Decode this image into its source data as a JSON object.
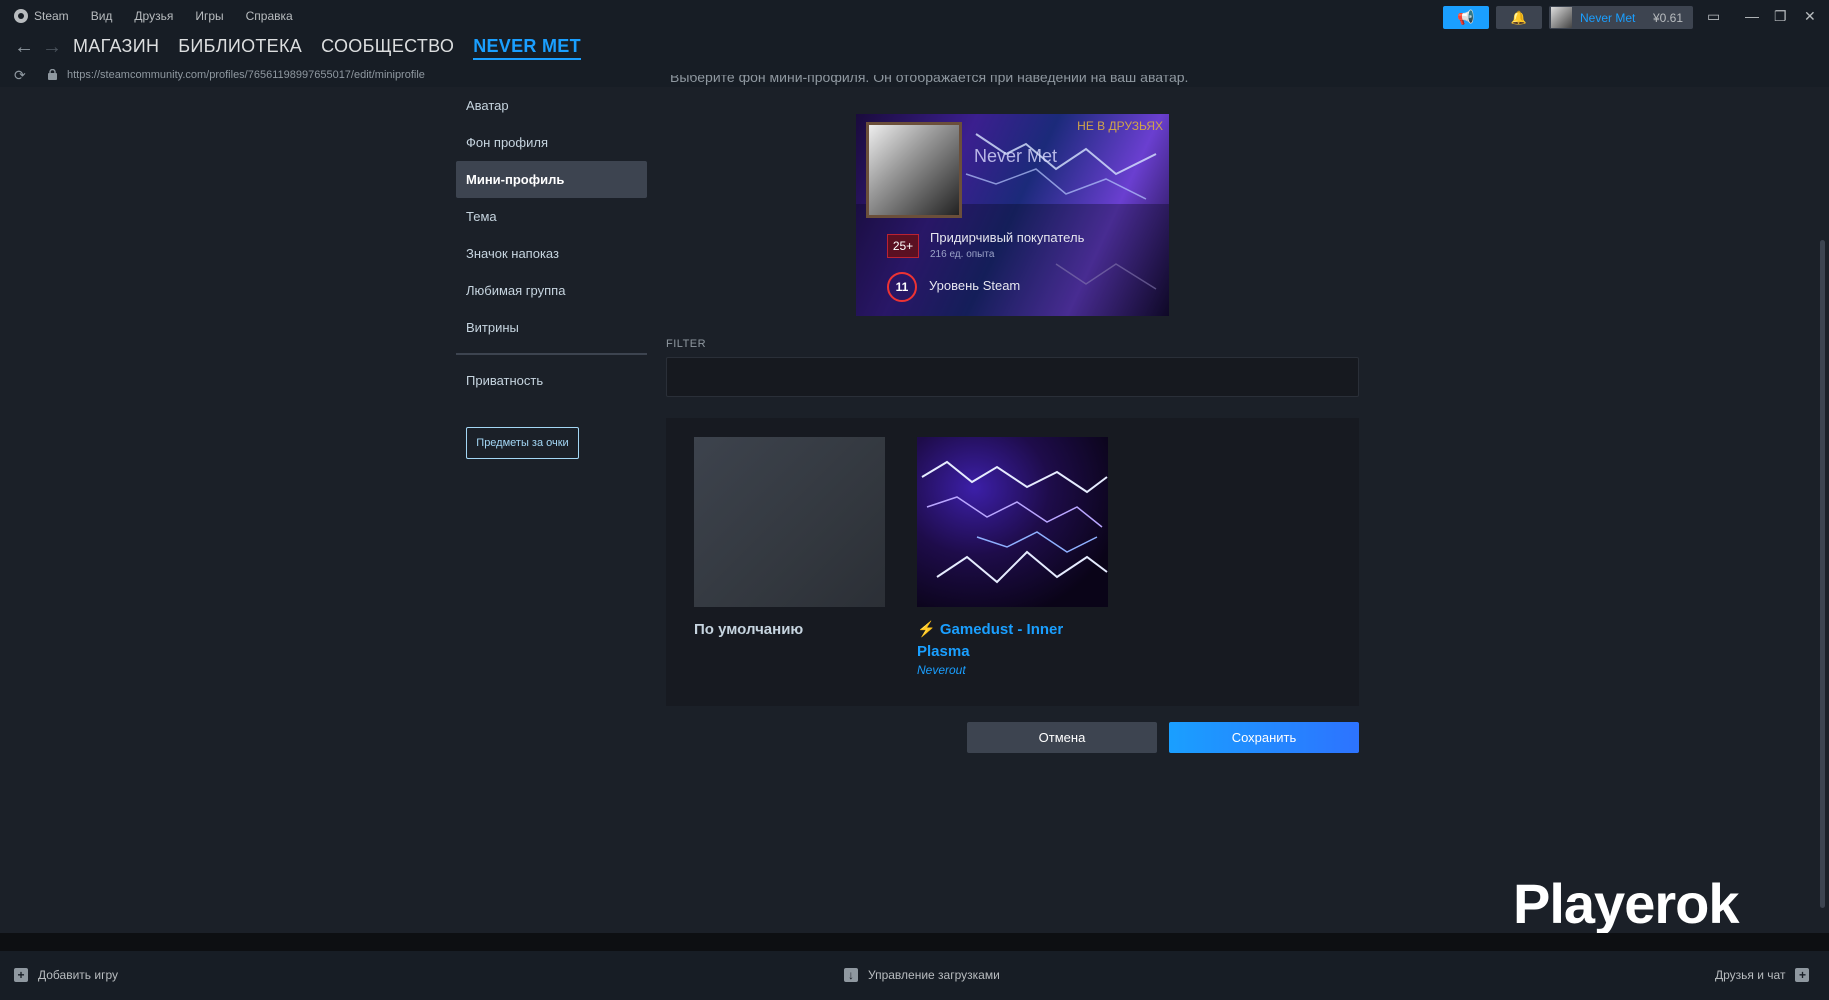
{
  "menu": {
    "steam": "Steam",
    "view": "Вид",
    "friends": "Друзья",
    "games": "Игры",
    "help": "Справка"
  },
  "nav": {
    "store": "МАГАЗИН",
    "library": "БИБЛИОТЕКА",
    "community": "СООБЩЕСТВО",
    "profile": "NEVER MET"
  },
  "url": "https://steamcommunity.com/profiles/76561198997655017/edit/miniprofile",
  "user": {
    "name": "Never Met",
    "balance": "¥0.61"
  },
  "sidebar": {
    "items": [
      {
        "label": "Аватар"
      },
      {
        "label": "Фон профиля"
      },
      {
        "label": "Мини-профиль"
      },
      {
        "label": "Тема"
      },
      {
        "label": "Значок напоказ"
      },
      {
        "label": "Любимая группа"
      },
      {
        "label": "Витрины"
      }
    ],
    "privacy": "Приватность",
    "points_button": "Предметы за очки"
  },
  "hint": "Выберите фон мини-профиля. Он отображается при наведении на ваш аватар.",
  "miniprofile": {
    "not_friends": "НЕ В ДРУЗЬЯХ",
    "name": "Never Met",
    "badge_level": "25+",
    "badge_title": "Придирчивый покупатель",
    "badge_xp": "216 ед. опыта",
    "steam_level": "11",
    "steam_level_label": "Уровень Steam"
  },
  "filter": {
    "label": "FILTER",
    "value": ""
  },
  "items": [
    {
      "title": "По умолчанию",
      "subtitle": ""
    },
    {
      "title": "⚡ Gamedust - Inner Plasma",
      "subtitle": "Neverout"
    }
  ],
  "buttons": {
    "cancel": "Отмена",
    "save": "Сохранить"
  },
  "watermark": "Playerok",
  "bottom": {
    "add_game": "Добавить игру",
    "downloads": "Управление загрузками",
    "friends_chat": "Друзья и чат"
  },
  "colors": {
    "accent": "#1a9fff",
    "background": "#1b2028",
    "panel": "#3d4450"
  }
}
